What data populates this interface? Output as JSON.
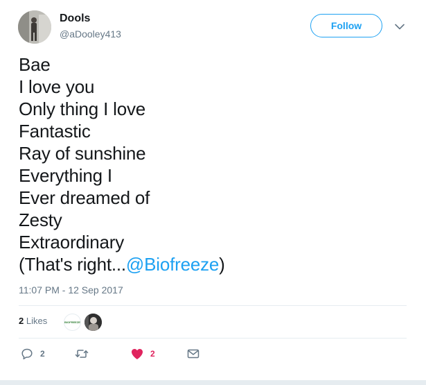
{
  "author": {
    "display_name": "Dools",
    "handle": "@aDooley413",
    "avatar_icon": "profile-photo"
  },
  "follow_label": "Follow",
  "menu_icon": "chevron-down-icon",
  "tweet": {
    "lines": [
      "Bae",
      "I love you",
      "Only thing I love",
      "Fantastic",
      "Ray of sunshine",
      "Everything I",
      "Ever dreamed of",
      "Zesty",
      "Extraordinary"
    ],
    "last_line_prefix": "(That's right...",
    "mention": "@Biofreeze",
    "last_line_suffix": ")",
    "timestamp": "11:07 PM - 12 Sep 2017"
  },
  "likes": {
    "count": "2",
    "label": "Likes",
    "liker_1_text": "BIOFREEZE",
    "liker_2_icon": "profile-photo"
  },
  "actions": {
    "reply_count": "2",
    "retweet_count": "",
    "like_count": "2",
    "reply_icon": "reply-icon",
    "retweet_icon": "retweet-icon",
    "like_icon": "heart-icon",
    "dm_icon": "envelope-icon"
  },
  "colors": {
    "accent": "#1da1f2",
    "like": "#e0245e",
    "muted": "#657786",
    "text": "#14171a",
    "divider": "#e6ecf0"
  }
}
